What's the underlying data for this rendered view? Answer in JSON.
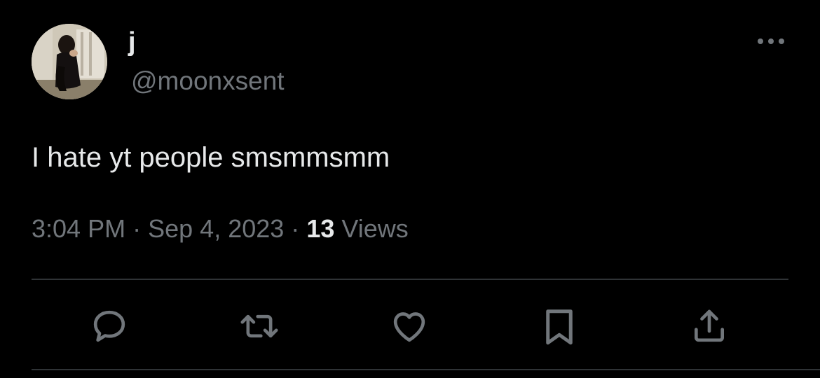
{
  "tweet": {
    "display_name": "j",
    "handle": "@moonxsent",
    "text": "I hate yt people smsmmsmm",
    "time": "3:04 PM",
    "separator": "·",
    "date": "Sep 4, 2023",
    "views_count": "13",
    "views_label": "Views"
  },
  "icons": {
    "more": "more-horizontal-icon",
    "reply": "reply-bubble-icon",
    "retweet": "retweet-icon",
    "like": "heart-icon",
    "bookmark": "bookmark-icon",
    "share": "share-upload-icon"
  },
  "colors": {
    "background": "#000000",
    "primary_text": "#e7e9ea",
    "secondary_text": "#71767b",
    "divider": "#2f3336"
  }
}
